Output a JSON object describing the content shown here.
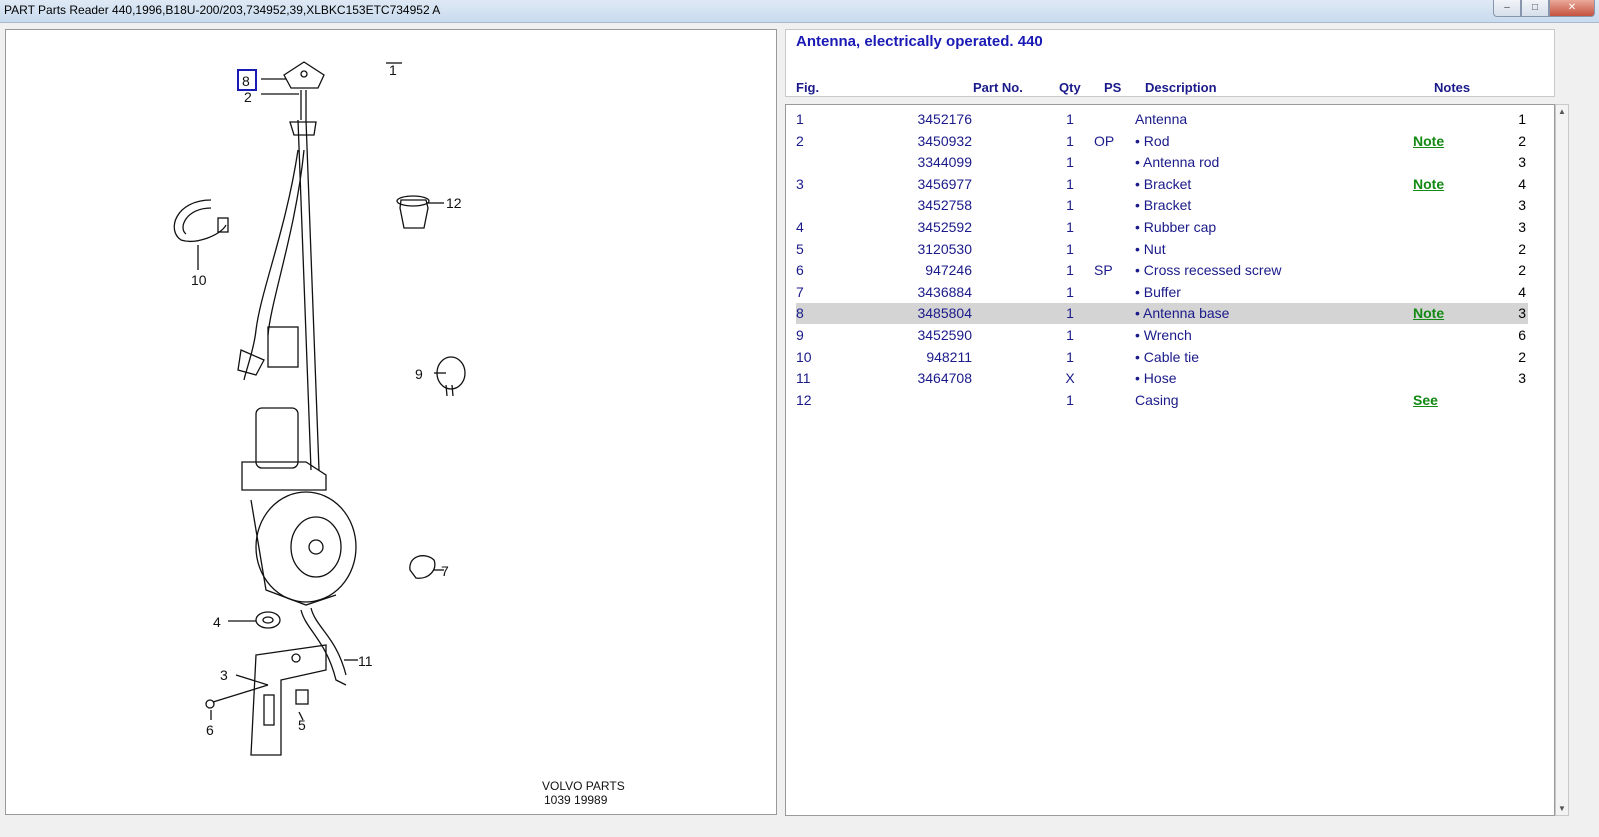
{
  "window": {
    "title": "PART Parts Reader 440,1996,B18U-200/203,734952,39,XLBKC153ETC734952 A",
    "btn_min": "–",
    "btn_max": "□",
    "btn_close": "✕"
  },
  "section": {
    "title": "Antenna, electrically operated. 440"
  },
  "columns": {
    "fig": "Fig.",
    "part": "Part No.",
    "qty": "Qty",
    "ps": "PS",
    "desc": "Description",
    "notes": "Notes"
  },
  "rows": [
    {
      "fig": "1",
      "part": "3452176",
      "qty": "1",
      "ps": "",
      "desc": "Antenna",
      "note": "",
      "num": "1"
    },
    {
      "fig": "2",
      "part": "3450932",
      "qty": "1",
      "ps": "OP",
      "desc": "• Rod",
      "note": "Note",
      "num": "2"
    },
    {
      "fig": "",
      "part": "3344099",
      "qty": "1",
      "ps": "",
      "desc": "• Antenna rod",
      "note": "",
      "num": "3"
    },
    {
      "fig": "3",
      "part": "3456977",
      "qty": "1",
      "ps": "",
      "desc": "• Bracket",
      "note": "Note",
      "num": "4"
    },
    {
      "fig": "",
      "part": "3452758",
      "qty": "1",
      "ps": "",
      "desc": "• Bracket",
      "note": "",
      "num": "3"
    },
    {
      "fig": "4",
      "part": "3452592",
      "qty": "1",
      "ps": "",
      "desc": "• Rubber cap",
      "note": "",
      "num": "3"
    },
    {
      "fig": "5",
      "part": "3120530",
      "qty": "1",
      "ps": "",
      "desc": "• Nut",
      "note": "",
      "num": "2"
    },
    {
      "fig": "6",
      "part": "947246",
      "qty": "1",
      "ps": "SP",
      "desc": "• Cross recessed screw",
      "note": "",
      "num": "2"
    },
    {
      "fig": "7",
      "part": "3436884",
      "qty": "1",
      "ps": "",
      "desc": "• Buffer",
      "note": "",
      "num": "4"
    },
    {
      "fig": "8",
      "part": "3485804",
      "qty": "1",
      "ps": "",
      "desc": "• Antenna base",
      "note": "Note",
      "num": "3",
      "selected": true
    },
    {
      "fig": "9",
      "part": "3452590",
      "qty": "1",
      "ps": "",
      "desc": "• Wrench",
      "note": "",
      "num": "6"
    },
    {
      "fig": "10",
      "part": "948211",
      "qty": "1",
      "ps": "",
      "desc": "• Cable tie",
      "note": "",
      "num": "2"
    },
    {
      "fig": "11",
      "part": "3464708",
      "qty": "X",
      "ps": "",
      "desc": "• Hose",
      "note": "",
      "num": "3"
    },
    {
      "fig": "12",
      "part": "",
      "qty": "1",
      "ps": "",
      "desc": "Casing",
      "note": "See",
      "num": ""
    }
  ],
  "diagram": {
    "callouts": [
      "1",
      "2",
      "3",
      "4",
      "5",
      "6",
      "7",
      "8",
      "9",
      "10",
      "11",
      "12"
    ],
    "selected_callout": "8",
    "watermark_line1": "VOLVO PARTS",
    "watermark_line2": "1039 19989"
  },
  "colors": {
    "header_text": "#1a1a8a",
    "title_text": "#1a1ab5",
    "note_link": "#138a13",
    "selected_row": "#d4d4d4"
  }
}
